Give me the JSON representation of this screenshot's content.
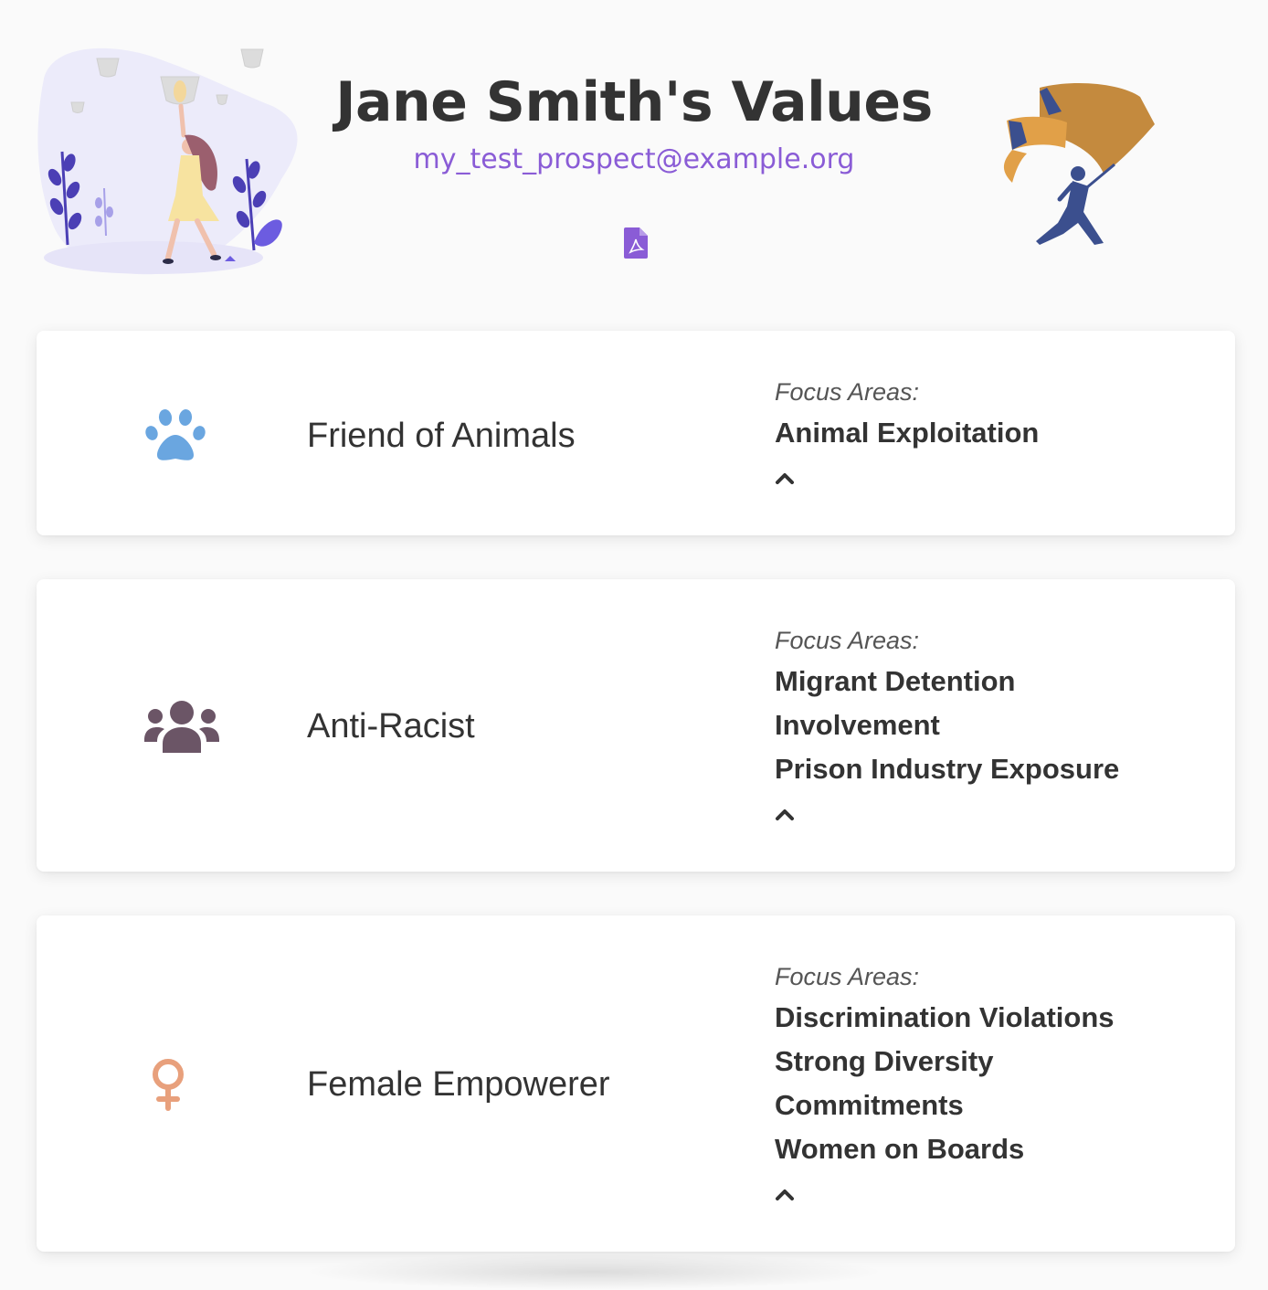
{
  "header": {
    "title": "Jane Smith's Values",
    "email": "my_test_prospect@example.org",
    "pdf_icon": "file-pdf-icon"
  },
  "cards": [
    {
      "title": "Friend of Animals",
      "icon": "paw-icon",
      "icon_color": "#6aa6e0",
      "focus_label": "Focus Areas:",
      "focus_areas": [
        "Animal Exploitation"
      ]
    },
    {
      "title": "Anti-Racist",
      "icon": "users-icon",
      "icon_color": "#6b5566",
      "focus_label": "Focus Areas:",
      "focus_areas": [
        "Migrant Detention",
        "Involvement",
        "Prison Industry Exposure"
      ]
    },
    {
      "title": "Female Empowerer",
      "icon": "venus-icon",
      "icon_color": "#e8a07c",
      "focus_label": "Focus Areas:",
      "focus_areas": [
        "Discrimination Violations",
        "Strong Diversity",
        "Commitments",
        "Women on Boards"
      ]
    }
  ],
  "colors": {
    "accent": "#8a5cd6",
    "background": "#fafafa",
    "text": "#333333"
  }
}
